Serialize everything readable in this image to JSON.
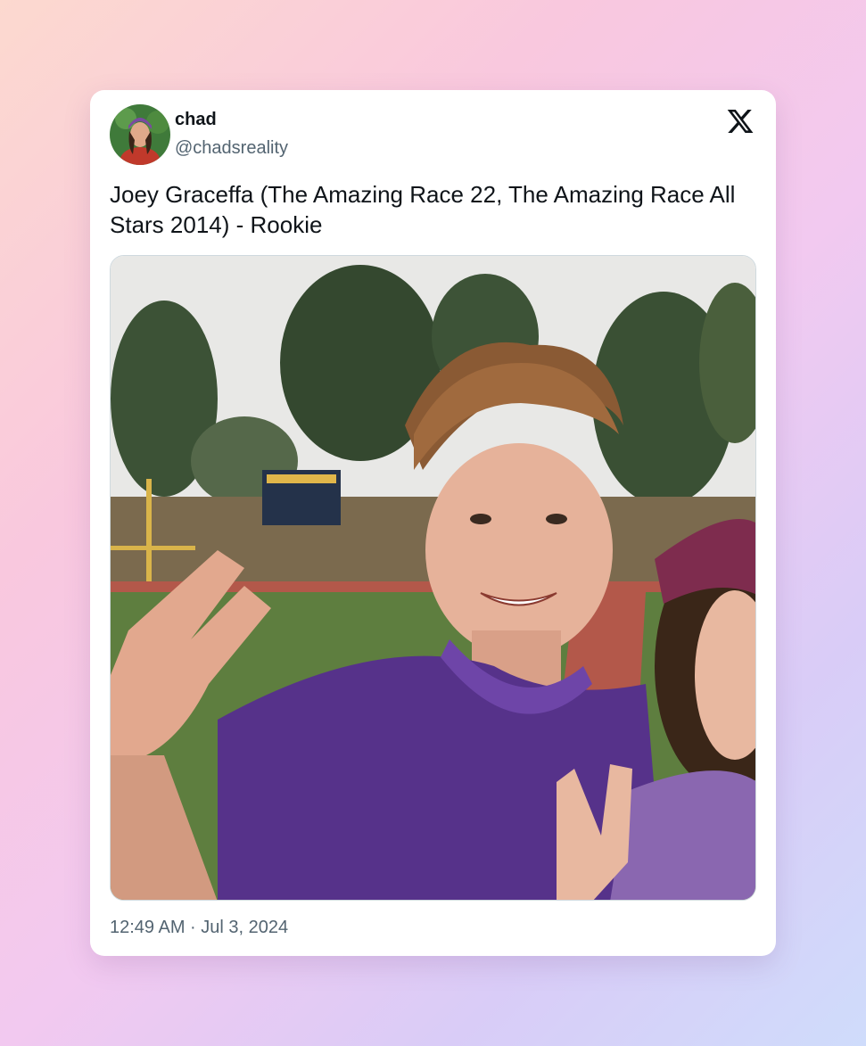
{
  "tweet": {
    "display_name": "chad",
    "handle": "@chadsreality",
    "text": "Joey Graceffa (The Amazing Race 22, The Amazing Race All Stars 2014) - Rookie",
    "timestamp": "12:49 AM · Jul 3, 2024",
    "brand_icon": "x-logo-icon",
    "media_description_icon": "photo"
  },
  "colors": {
    "text_primary": "#0f1419",
    "text_secondary": "#536471",
    "card_bg": "#ffffff",
    "border": "#cfd9de"
  }
}
